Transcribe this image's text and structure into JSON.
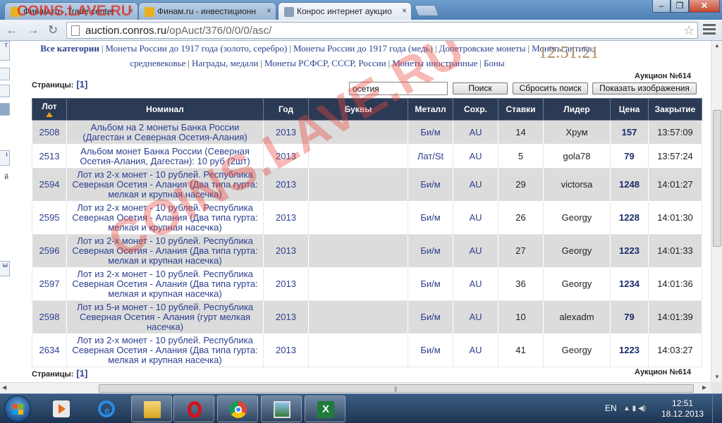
{
  "browser": {
    "tabs": [
      {
        "title": "Финам.ru - Trade center"
      },
      {
        "title": "Финам.ru - инвестиционн"
      },
      {
        "title": "Конрос интернет аукцио"
      }
    ],
    "url_host": "auction.conros.ru",
    "url_path": "/opAuct/376/0/0/0/asc/"
  },
  "watermark": {
    "small": "COINS.LAVE.RU",
    "big": "COINS.LAVE.RU"
  },
  "left_strip": {
    "items": [
      "т",
      "ı",
      "й",
      "ы"
    ]
  },
  "categories": {
    "all": "Все категории",
    "items": [
      "Монеты России до 1917 года (золото, серебро)",
      "Монеты России до 1917 года (медь)",
      "Допетровские монеты",
      "Монеты антика,",
      "средневековье",
      "Награды, медали",
      "Монеты РСФСР, СССР, России",
      "Монеты иностранные",
      "Боны"
    ]
  },
  "clock": "12:51:21",
  "auction_label": "Аукцион №614",
  "pages_label": "Страницы:",
  "page_link": "[1]",
  "search": {
    "value": "осетия",
    "search_button": "Поиск",
    "reset_button": "Сбросить поиск",
    "show_images_button": "Показать изображения"
  },
  "table": {
    "headers": [
      "Лот",
      "Номинал",
      "Год",
      "Буквы",
      "Металл",
      "Сохр.",
      "Ставки",
      "Лидер",
      "Цена",
      "Закрытие"
    ],
    "rows": [
      {
        "lot": "2508",
        "name": "Альбом на 2 монеты Банка России (Дагестан и Северная Осетия-Алания)",
        "year": "2013",
        "letters": "",
        "metal": "Би/м",
        "grade": "AU",
        "bids": "14",
        "leader": "Хрум",
        "price": "157",
        "close": "13:57:09"
      },
      {
        "lot": "2513",
        "name": "Альбом монет Банка России (Северная Осетия-Алания, Дагестан): 10 руб (2шт)",
        "year": "2013",
        "letters": "",
        "metal": "Лат/St",
        "grade": "AU",
        "bids": "5",
        "leader": "gola78",
        "price": "79",
        "close": "13:57:24"
      },
      {
        "lot": "2594",
        "name": "Лот из 2-х монет - 10 рублей. Республика Северная Осетия - Алания (Два типа гурта: мелкая и крупная насечка)",
        "year": "2013",
        "letters": "",
        "metal": "Би/м",
        "grade": "AU",
        "bids": "29",
        "leader": "victorsa",
        "price": "1248",
        "close": "14:01:27"
      },
      {
        "lot": "2595",
        "name": "Лот из 2-х монет - 10 рублей. Республика Северная Осетия - Алания (Два типа гурта: мелкая и крупная насечка)",
        "year": "2013",
        "letters": "",
        "metal": "Би/м",
        "grade": "AU",
        "bids": "26",
        "leader": "Georgy",
        "price": "1228",
        "close": "14:01:30"
      },
      {
        "lot": "2596",
        "name": "Лот из 2-х монет - 10 рублей. Республика Северная Осетия - Алания (Два типа гурта: мелкая и крупная насечка)",
        "year": "2013",
        "letters": "",
        "metal": "Би/м",
        "grade": "AU",
        "bids": "27",
        "leader": "Georgy",
        "price": "1223",
        "close": "14:01:33"
      },
      {
        "lot": "2597",
        "name": "Лот из 2-х монет - 10 рублей. Республика Северная Осетия - Алания (Два типа гурта: мелкая и крупная насечка)",
        "year": "2013",
        "letters": "",
        "metal": "Би/м",
        "grade": "AU",
        "bids": "36",
        "leader": "Georgy",
        "price": "1234",
        "close": "14:01:36"
      },
      {
        "lot": "2598",
        "name": "Лот из 5-и монет - 10 рублей. Республика Северная Осетия - Алания (гурт мелкая насечка)",
        "year": "2013",
        "letters": "",
        "metal": "Би/м",
        "grade": "AU",
        "bids": "10",
        "leader": "alexadm",
        "price": "79",
        "close": "14:01:39"
      },
      {
        "lot": "2634",
        "name": "Лот из 2-х монет - 10 рублей. Республика Северная Осетия - Алания (Два типа гурта: мелкая и крупная насечка)",
        "year": "2013",
        "letters": "",
        "metal": "Би/м",
        "grade": "AU",
        "bids": "41",
        "leader": "Georgy",
        "price": "1223",
        "close": "14:03:27"
      }
    ]
  },
  "taskbar": {
    "lang": "EN",
    "time": "12:51",
    "date": "18.12.2013"
  },
  "colors": {
    "header_bg": "#2b3a55",
    "link": "#2c3f8f",
    "row_alt": "#dcdcdc",
    "clock": "#b28a60",
    "watermark": "#eb463c"
  }
}
